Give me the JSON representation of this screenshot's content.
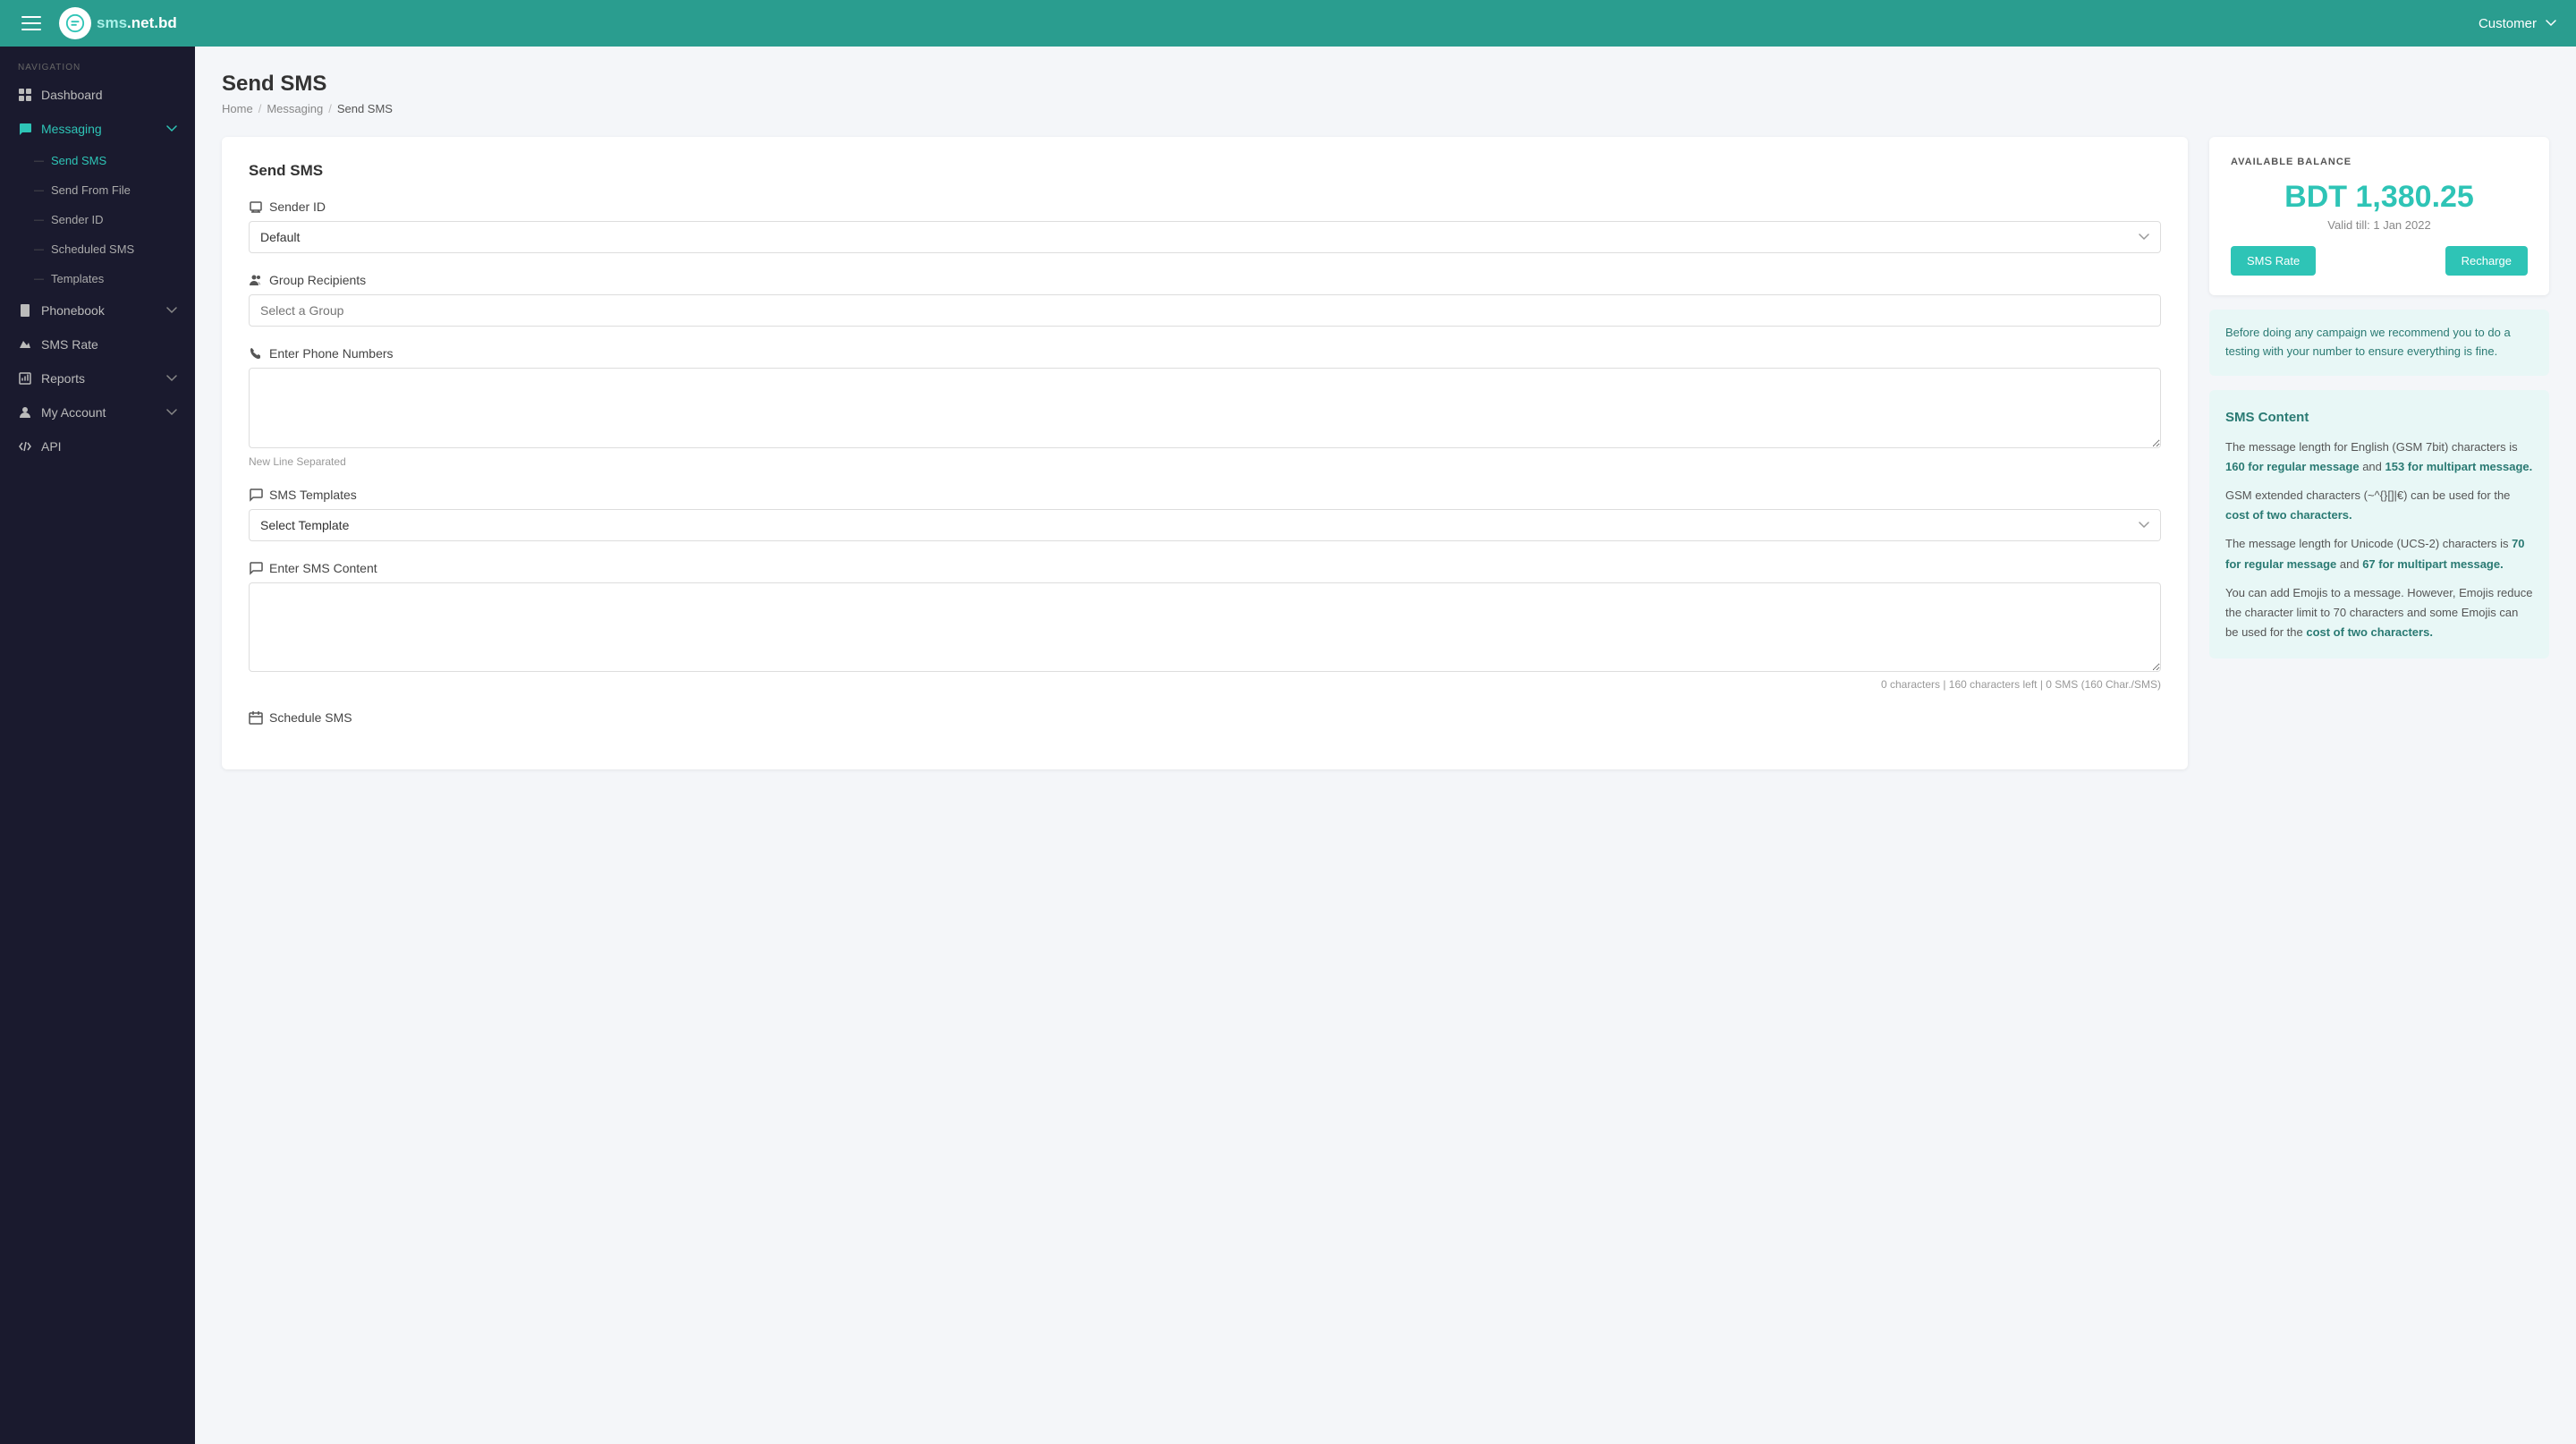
{
  "app": {
    "logo_text_main": "sms",
    "logo_text_domain": ".net.bd"
  },
  "topnav": {
    "user_label": "Customer",
    "chevron": "▾"
  },
  "sidebar": {
    "nav_label": "NAVIGATION",
    "items": [
      {
        "id": "dashboard",
        "label": "Dashboard",
        "icon": "dashboard-icon"
      },
      {
        "id": "messaging",
        "label": "Messaging",
        "icon": "messaging-icon",
        "active": true,
        "expanded": true
      },
      {
        "id": "phonebook",
        "label": "Phonebook",
        "icon": "phonebook-icon",
        "hasChevron": true
      },
      {
        "id": "sms-rate",
        "label": "SMS Rate",
        "icon": "sms-rate-icon"
      },
      {
        "id": "reports",
        "label": "Reports",
        "icon": "reports-icon",
        "hasChevron": true
      },
      {
        "id": "my-account",
        "label": "My Account",
        "icon": "my-account-icon",
        "hasChevron": true
      },
      {
        "id": "api",
        "label": "API",
        "icon": "api-icon"
      }
    ],
    "sub_items": [
      {
        "id": "send-sms",
        "label": "Send SMS",
        "active": true
      },
      {
        "id": "send-from-file",
        "label": "Send From File"
      },
      {
        "id": "sender-id",
        "label": "Sender ID"
      },
      {
        "id": "scheduled-sms",
        "label": "Scheduled SMS"
      },
      {
        "id": "templates",
        "label": "Templates"
      }
    ]
  },
  "page": {
    "title": "Send SMS",
    "breadcrumb": {
      "home": "Home",
      "section": "Messaging",
      "current": "Send SMS"
    }
  },
  "form": {
    "card_title": "Send SMS",
    "sender_id_label": "Sender ID",
    "sender_id_default": "Default",
    "sender_id_options": [
      "Default"
    ],
    "group_recipients_label": "Group Recipients",
    "group_recipients_placeholder": "Select a Group",
    "phone_numbers_label": "Enter Phone Numbers",
    "phone_numbers_hint": "New Line Separated",
    "sms_templates_label": "SMS Templates",
    "sms_templates_placeholder": "Select Template",
    "sms_templates_options": [
      "Select Template"
    ],
    "sms_content_label": "Enter SMS Content",
    "char_count": "0 characters | 160 characters left | 0 SMS (160 Char./SMS)",
    "schedule_label": "Schedule SMS"
  },
  "balance": {
    "section_label": "AVAILABLE BALANCE",
    "currency": "BDT",
    "amount": "1,380.25",
    "valid_label": "Valid till: 1 Jan 2022",
    "sms_rate_btn": "SMS Rate",
    "recharge_btn": "Recharge"
  },
  "info_card": {
    "text": "Before doing any campaign we recommend you to do a testing with your number to ensure everything is fine."
  },
  "sms_content_info": {
    "title": "SMS Content",
    "p1_pre": "The message length for English (GSM 7bit) characters is ",
    "p1_bold1": "160 for regular message",
    "p1_mid": " and ",
    "p1_bold2": "153 for multipart message.",
    "p2_pre": "GSM extended characters (~^{}[]|€) can be used for the ",
    "p2_bold": "cost of two characters.",
    "p3_pre": "The message length for Unicode (UCS-2) characters is ",
    "p3_bold1": "70 for regular message",
    "p3_mid": " and ",
    "p3_bold2": "67 for multipart message.",
    "p4_pre": "You can add Emojis to a message. However, Emojis reduce the character limit to 70 characters and some Emojis can be used for the ",
    "p4_bold": "cost of two characters."
  }
}
